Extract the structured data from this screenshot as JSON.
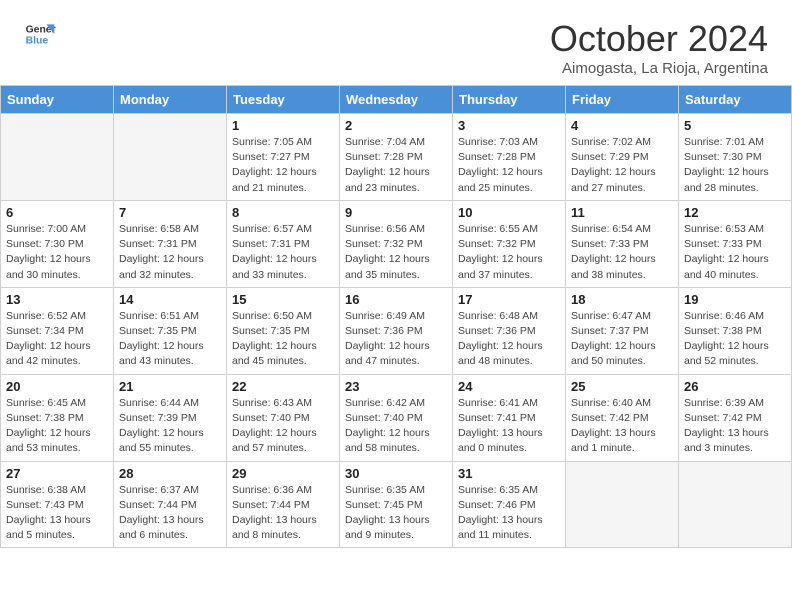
{
  "header": {
    "logo_line1": "General",
    "logo_line2": "Blue",
    "month": "October 2024",
    "location": "Aimogasta, La Rioja, Argentina"
  },
  "days_of_week": [
    "Sunday",
    "Monday",
    "Tuesday",
    "Wednesday",
    "Thursday",
    "Friday",
    "Saturday"
  ],
  "weeks": [
    [
      {
        "day": "",
        "empty": true
      },
      {
        "day": "",
        "empty": true
      },
      {
        "day": "1",
        "sunrise": "7:05 AM",
        "sunset": "7:27 PM",
        "daylight": "12 hours and 21 minutes."
      },
      {
        "day": "2",
        "sunrise": "7:04 AM",
        "sunset": "7:28 PM",
        "daylight": "12 hours and 23 minutes."
      },
      {
        "day": "3",
        "sunrise": "7:03 AM",
        "sunset": "7:28 PM",
        "daylight": "12 hours and 25 minutes."
      },
      {
        "day": "4",
        "sunrise": "7:02 AM",
        "sunset": "7:29 PM",
        "daylight": "12 hours and 27 minutes."
      },
      {
        "day": "5",
        "sunrise": "7:01 AM",
        "sunset": "7:30 PM",
        "daylight": "12 hours and 28 minutes."
      }
    ],
    [
      {
        "day": "6",
        "sunrise": "7:00 AM",
        "sunset": "7:30 PM",
        "daylight": "12 hours and 30 minutes."
      },
      {
        "day": "7",
        "sunrise": "6:58 AM",
        "sunset": "7:31 PM",
        "daylight": "12 hours and 32 minutes."
      },
      {
        "day": "8",
        "sunrise": "6:57 AM",
        "sunset": "7:31 PM",
        "daylight": "12 hours and 33 minutes."
      },
      {
        "day": "9",
        "sunrise": "6:56 AM",
        "sunset": "7:32 PM",
        "daylight": "12 hours and 35 minutes."
      },
      {
        "day": "10",
        "sunrise": "6:55 AM",
        "sunset": "7:32 PM",
        "daylight": "12 hours and 37 minutes."
      },
      {
        "day": "11",
        "sunrise": "6:54 AM",
        "sunset": "7:33 PM",
        "daylight": "12 hours and 38 minutes."
      },
      {
        "day": "12",
        "sunrise": "6:53 AM",
        "sunset": "7:33 PM",
        "daylight": "12 hours and 40 minutes."
      }
    ],
    [
      {
        "day": "13",
        "sunrise": "6:52 AM",
        "sunset": "7:34 PM",
        "daylight": "12 hours and 42 minutes."
      },
      {
        "day": "14",
        "sunrise": "6:51 AM",
        "sunset": "7:35 PM",
        "daylight": "12 hours and 43 minutes."
      },
      {
        "day": "15",
        "sunrise": "6:50 AM",
        "sunset": "7:35 PM",
        "daylight": "12 hours and 45 minutes."
      },
      {
        "day": "16",
        "sunrise": "6:49 AM",
        "sunset": "7:36 PM",
        "daylight": "12 hours and 47 minutes."
      },
      {
        "day": "17",
        "sunrise": "6:48 AM",
        "sunset": "7:36 PM",
        "daylight": "12 hours and 48 minutes."
      },
      {
        "day": "18",
        "sunrise": "6:47 AM",
        "sunset": "7:37 PM",
        "daylight": "12 hours and 50 minutes."
      },
      {
        "day": "19",
        "sunrise": "6:46 AM",
        "sunset": "7:38 PM",
        "daylight": "12 hours and 52 minutes."
      }
    ],
    [
      {
        "day": "20",
        "sunrise": "6:45 AM",
        "sunset": "7:38 PM",
        "daylight": "12 hours and 53 minutes."
      },
      {
        "day": "21",
        "sunrise": "6:44 AM",
        "sunset": "7:39 PM",
        "daylight": "12 hours and 55 minutes."
      },
      {
        "day": "22",
        "sunrise": "6:43 AM",
        "sunset": "7:40 PM",
        "daylight": "12 hours and 57 minutes."
      },
      {
        "day": "23",
        "sunrise": "6:42 AM",
        "sunset": "7:40 PM",
        "daylight": "12 hours and 58 minutes."
      },
      {
        "day": "24",
        "sunrise": "6:41 AM",
        "sunset": "7:41 PM",
        "daylight": "13 hours and 0 minutes."
      },
      {
        "day": "25",
        "sunrise": "6:40 AM",
        "sunset": "7:42 PM",
        "daylight": "13 hours and 1 minute."
      },
      {
        "day": "26",
        "sunrise": "6:39 AM",
        "sunset": "7:42 PM",
        "daylight": "13 hours and 3 minutes."
      }
    ],
    [
      {
        "day": "27",
        "sunrise": "6:38 AM",
        "sunset": "7:43 PM",
        "daylight": "13 hours and 5 minutes."
      },
      {
        "day": "28",
        "sunrise": "6:37 AM",
        "sunset": "7:44 PM",
        "daylight": "13 hours and 6 minutes."
      },
      {
        "day": "29",
        "sunrise": "6:36 AM",
        "sunset": "7:44 PM",
        "daylight": "13 hours and 8 minutes."
      },
      {
        "day": "30",
        "sunrise": "6:35 AM",
        "sunset": "7:45 PM",
        "daylight": "13 hours and 9 minutes."
      },
      {
        "day": "31",
        "sunrise": "6:35 AM",
        "sunset": "7:46 PM",
        "daylight": "13 hours and 11 minutes."
      },
      {
        "day": "",
        "empty": true
      },
      {
        "day": "",
        "empty": true
      }
    ]
  ],
  "labels": {
    "sunrise": "Sunrise:",
    "sunset": "Sunset:",
    "daylight": "Daylight:"
  }
}
